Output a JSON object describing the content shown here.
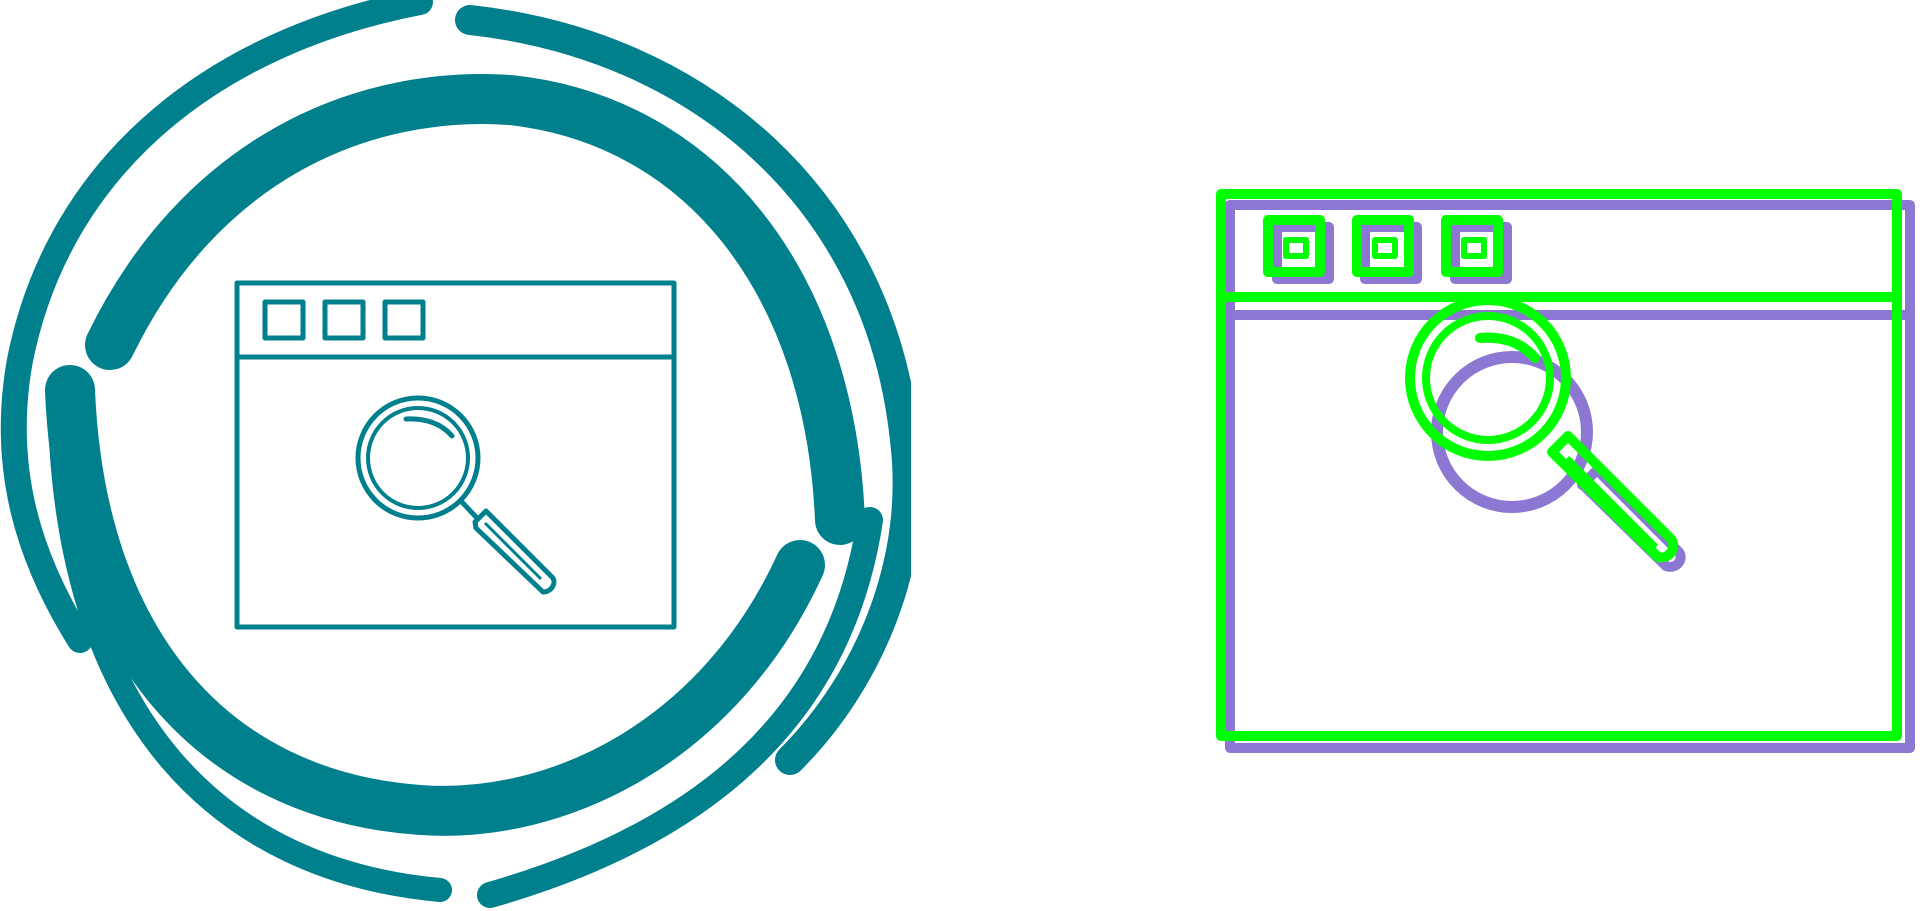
{
  "icons": {
    "left": {
      "name": "browser-search-icon-glyph-style",
      "style": "circular-swirl-outline",
      "color": "#007F8C"
    },
    "right": {
      "name": "browser-search-icon-two-tone-style",
      "style": "offset-outline",
      "primary_color": "#00FF00",
      "shadow_color": "#8C78D2"
    }
  },
  "background": "#FFFFFF"
}
